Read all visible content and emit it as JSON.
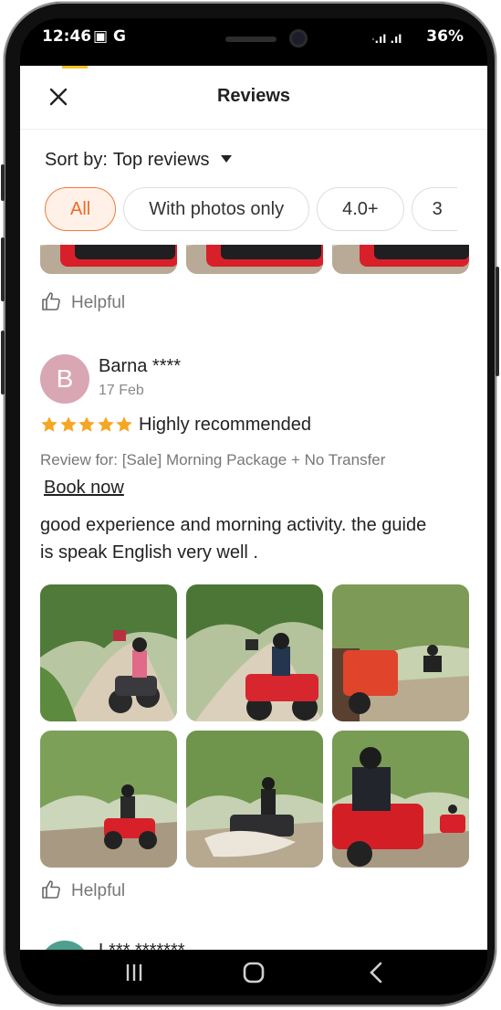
{
  "status": {
    "time": "12:46",
    "icons": "▣ G",
    "signal": "·.ıl .ıl",
    "battery": "36%"
  },
  "header": {
    "title": "Reviews",
    "close_icon": "close-icon"
  },
  "sort": {
    "label": "Sort by:",
    "value": "Top reviews"
  },
  "filters": [
    {
      "label": "All",
      "active": true
    },
    {
      "label": "With photos only",
      "active": false
    },
    {
      "label": "4.0+",
      "active": false
    },
    {
      "label": "3",
      "active": false
    }
  ],
  "prev_review": {
    "helpful_label": "Helpful"
  },
  "review": {
    "avatar_letter": "B",
    "user": "Barna ****",
    "date": "17 Feb",
    "rating": 5,
    "title": "Highly recommended",
    "review_for": "Review for: [Sale] Morning Package + No Transfer",
    "book_now": "Book now",
    "text": "good experience and morning activity. the guide is speak English very well .",
    "photo_count": 6,
    "helpful_label": "Helpful"
  },
  "next_review": {
    "user": "L*** *******"
  },
  "colors": {
    "accent": "#f06a24",
    "star": "#f5a623",
    "avatar": "#d9a6b4"
  },
  "navbar": {
    "recents_icon": "recents-icon",
    "home_icon": "home-icon",
    "back_icon": "back-icon"
  }
}
